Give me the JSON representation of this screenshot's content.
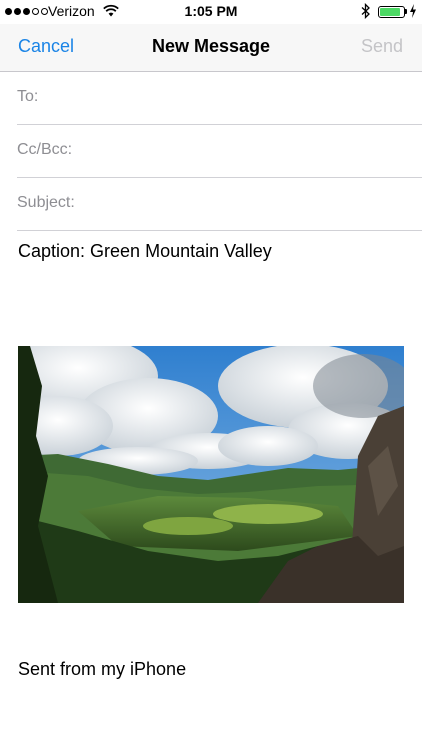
{
  "status_bar": {
    "carrier": "Verizon",
    "time": "1:05 PM",
    "signal_bars_filled": 3,
    "signal_bars_total": 5,
    "battery_level": 0.85,
    "battery_color": "#4cd964",
    "icons": [
      "wifi-icon",
      "bluetooth-icon",
      "battery-icon",
      "charging-icon"
    ]
  },
  "nav": {
    "cancel_label": "Cancel",
    "title": "New Message",
    "send_label": "Send",
    "accent_color": "#1a84e6",
    "disabled_color": "#c4c4c7"
  },
  "fields": {
    "to_label": "To:",
    "cc_label": "Cc/Bcc:",
    "subject_label": "Subject:"
  },
  "body": {
    "caption": "Caption: Green Mountain Valley",
    "signature": "Sent from my iPhone"
  }
}
